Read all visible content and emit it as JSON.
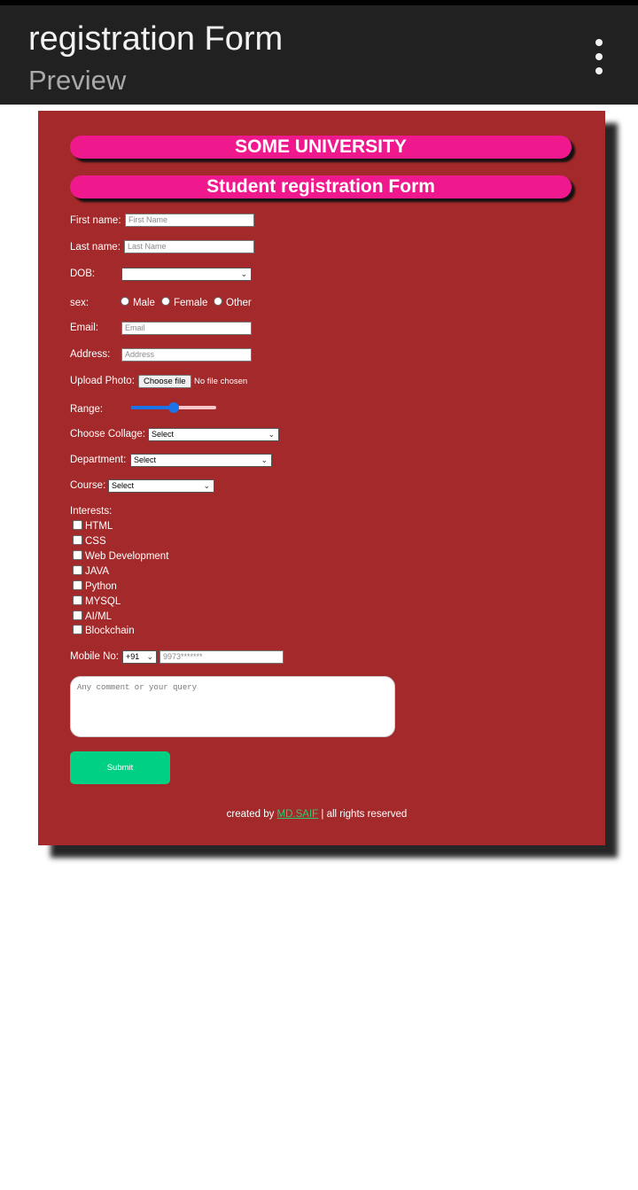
{
  "appbar": {
    "title": "registration Form",
    "subtitle": "Preview"
  },
  "banners": {
    "university": "SOME UNIVERSITY",
    "form_title": "Student registration Form"
  },
  "fields": {
    "first_name": {
      "label": "First name:",
      "placeholder": "First Name"
    },
    "last_name": {
      "label": "Last name:",
      "placeholder": "Last Name"
    },
    "dob": {
      "label": "DOB:",
      "value": ""
    },
    "sex": {
      "label": "sex:",
      "options": [
        "Male",
        "Female",
        "Other"
      ]
    },
    "email": {
      "label": "Email:",
      "placeholder": "Email"
    },
    "address": {
      "label": "Address:",
      "placeholder": "Address"
    },
    "upload": {
      "label": "Upload Photo:",
      "button": "Choose file",
      "status": "No file chosen"
    },
    "range": {
      "label": "Range:",
      "value": 0.5
    },
    "collage": {
      "label": "Choose Collage:",
      "value": "Select"
    },
    "department": {
      "label": "Department:",
      "value": "Select"
    },
    "course": {
      "label": "Course:",
      "value": "Select"
    },
    "interests": {
      "label": "Interests:",
      "items": [
        "HTML",
        "CSS",
        "Web Development",
        "JAVA",
        "Python",
        "MYSQL",
        "AI/ML",
        "Blockchain"
      ]
    },
    "mobile": {
      "label": "Mobile No:",
      "code": "+91",
      "placeholder": "9973*******"
    },
    "comment": {
      "placeholder": "Any comment or your query"
    }
  },
  "submit_label": "Submit",
  "footer": {
    "prefix": "created by",
    "author": "MD.SAIF",
    "suffix": "| all rights reserved"
  },
  "colors": {
    "card": "#a4292a",
    "banner": "#f0188d",
    "submit": "#00d084",
    "appbar": "#212121"
  }
}
